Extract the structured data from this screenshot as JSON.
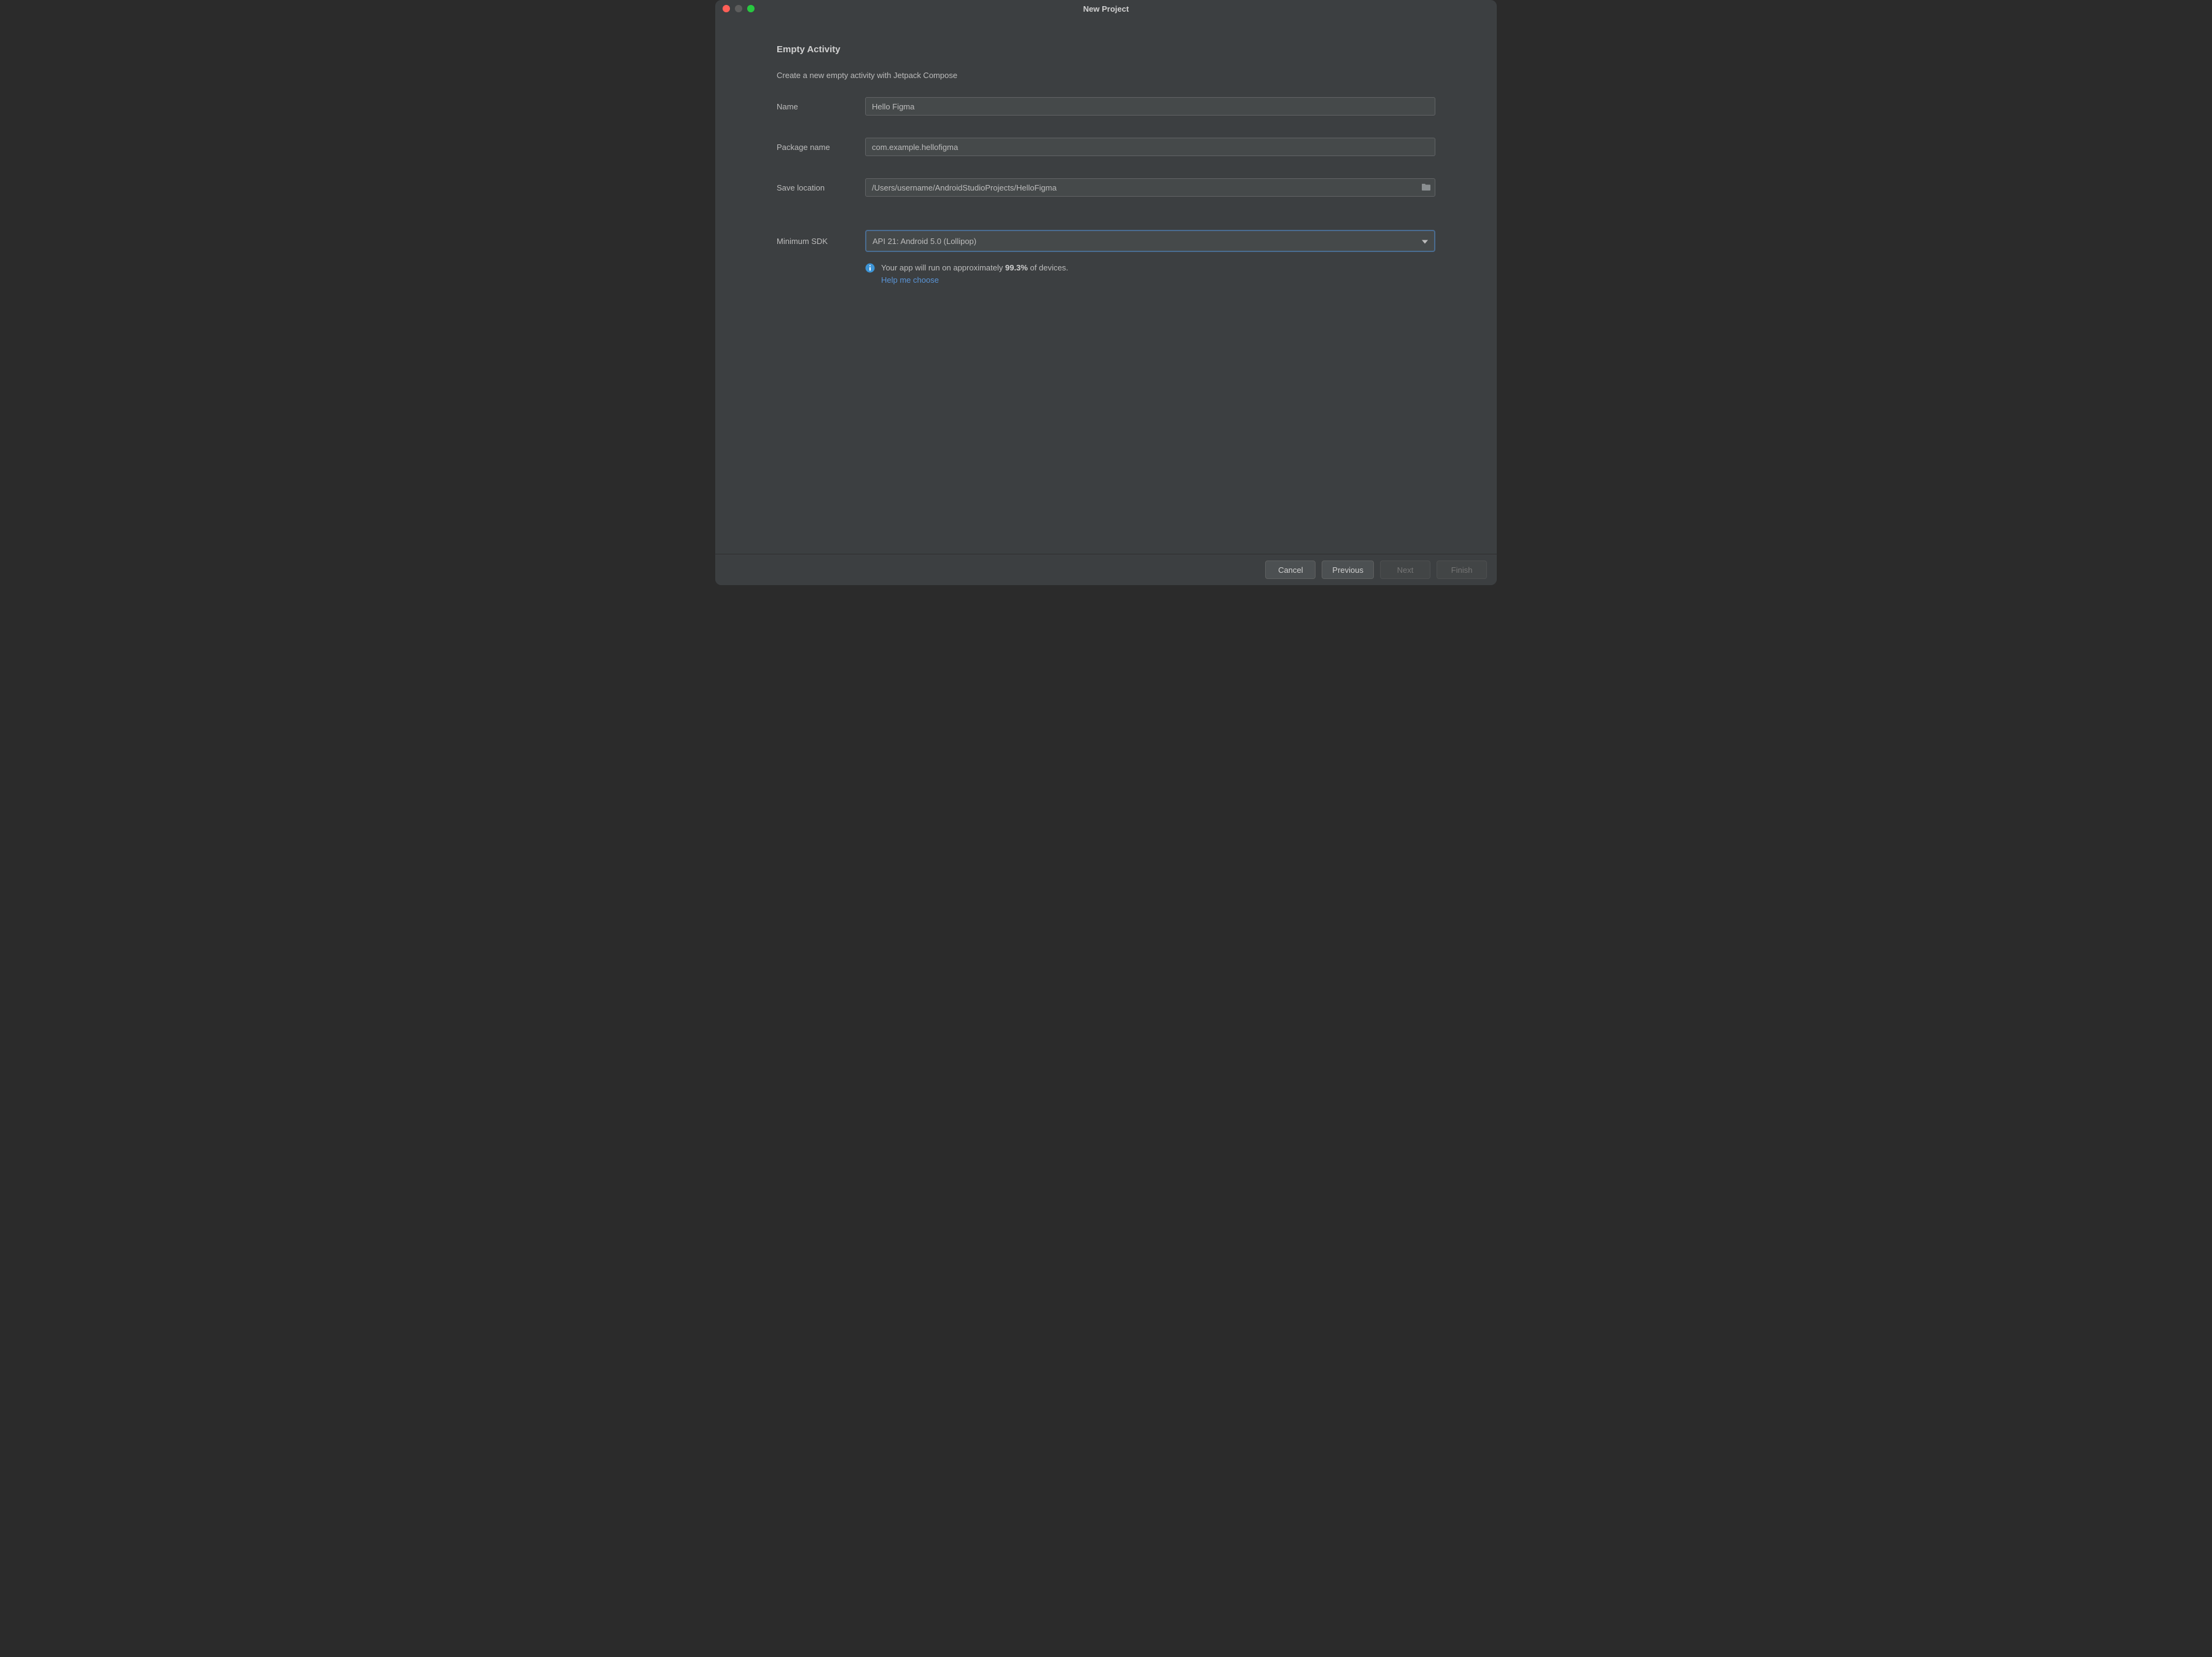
{
  "window": {
    "title": "New Project"
  },
  "header": {
    "heading": "Empty Activity",
    "subtitle": "Create a new empty activity with Jetpack Compose"
  },
  "form": {
    "name": {
      "label": "Name",
      "value": "Hello Figma"
    },
    "package": {
      "label": "Package name",
      "value": "com.example.hellofigma"
    },
    "location": {
      "label": "Save location",
      "value": "/Users/username/AndroidStudioProjects/HelloFigma"
    },
    "sdk": {
      "label": "Minimum SDK",
      "value": "API 21: Android 5.0 (Lollipop)"
    }
  },
  "info": {
    "text_pre": "Your app will run on approximately ",
    "percent": "99.3%",
    "text_post": " of devices.",
    "help_link": "Help me choose"
  },
  "footer": {
    "cancel": "Cancel",
    "previous": "Previous",
    "next": "Next",
    "finish": "Finish"
  }
}
